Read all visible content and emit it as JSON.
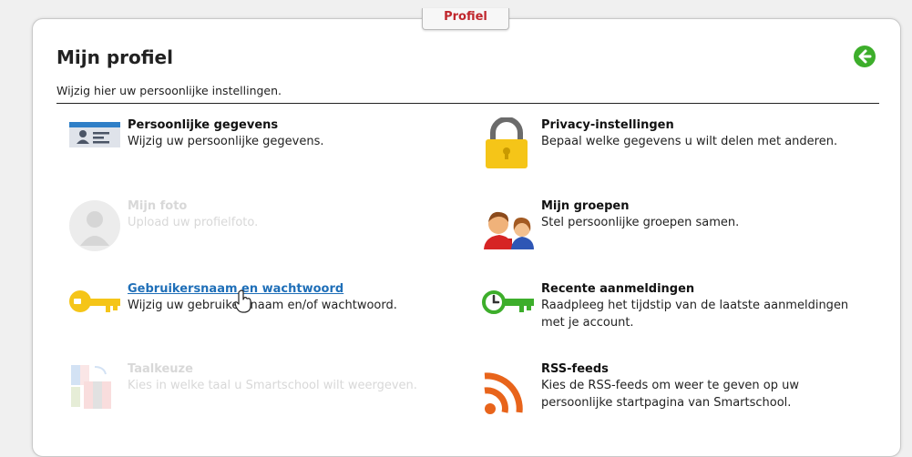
{
  "tab": {
    "label": "Profiel"
  },
  "header": {
    "title": "Mijn profiel",
    "subtitle": "Wijzig hier uw persoonlijke instellingen."
  },
  "items": [
    {
      "title": "Persoonlijke gegevens",
      "desc": "Wijzig uw persoonlijke gegevens.",
      "icon": "id-card-icon",
      "enabled": true
    },
    {
      "title": "Privacy-instellingen",
      "desc": "Bepaal welke gegevens u wilt delen met anderen.",
      "icon": "padlock-icon",
      "enabled": true
    },
    {
      "title": "Mijn foto",
      "desc": "Upload uw profielfoto.",
      "icon": "avatar-icon",
      "enabled": false
    },
    {
      "title": "Mijn groepen",
      "desc": "Stel persoonlijke groepen samen.",
      "icon": "group-icon",
      "enabled": true
    },
    {
      "title": "Gebruikersnaam en wachtwoord",
      "desc": "Wijzig uw gebruikersnaam en/of wachtwoord.",
      "icon": "key-icon",
      "enabled": true,
      "hovered": true
    },
    {
      "title": "Recente aanmeldingen",
      "desc": "Raadpleeg het tijdstip van de laatste aanmeldingen met je account.",
      "icon": "clock-key-icon",
      "enabled": true
    },
    {
      "title": "Taalkeuze",
      "desc": "Kies in welke taal u Smartschool wilt weergeven.",
      "icon": "language-flags-icon",
      "enabled": false
    },
    {
      "title": "RSS-feeds",
      "desc": "Kies de RSS-feeds om weer te geven op uw persoonlijke startpagina van Smartschool.",
      "icon": "rss-icon",
      "enabled": true
    }
  ],
  "colors": {
    "accent_green": "#3dae2b",
    "tab_red": "#c0272d",
    "link_blue": "#1f6fb8",
    "rss_orange": "#e8641b"
  }
}
